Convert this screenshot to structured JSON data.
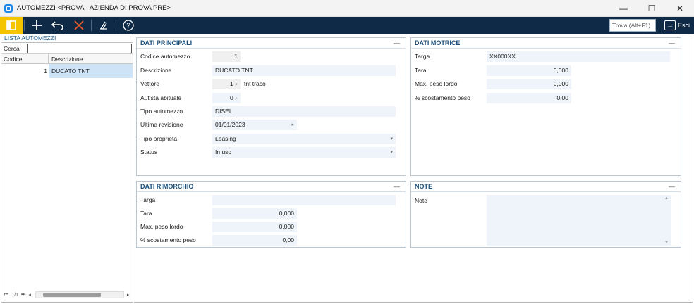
{
  "window": {
    "title": "AUTOMEZZI <PROVA - AZIENDA DI PROVA PRE>",
    "minimize": "—",
    "maximize": "☐",
    "close": "✕"
  },
  "toolbar": {
    "icons": [
      "panel-icon",
      "plus-icon",
      "undo-icon",
      "delete-icon",
      "sign-icon",
      "help-icon"
    ],
    "search_placeholder": "Trova (Alt+F1)",
    "exit_label": "Esci"
  },
  "list": {
    "title": "LISTA AUTOMEZZI",
    "search_label": "Cerca",
    "search_value": "",
    "columns": [
      "Codice",
      "Descrizione"
    ],
    "rows": [
      {
        "code": "1",
        "desc": "DUCATO TNT"
      }
    ],
    "pager": "1/1"
  },
  "dati_principali": {
    "title": "DATI PRINCIPALI",
    "fields": {
      "codice_label": "Codice automezzo",
      "codice_value": "1",
      "descrizione_label": "Descrizione",
      "descrizione_value": "DUCATO TNT",
      "vettore_label": "Vettore",
      "vettore_value": "1",
      "vettore_name": "tnt traco",
      "autista_label": "Autista abituale",
      "autista_value": "0",
      "tipo_label": "Tipo automezzo",
      "tipo_value": "DISEL",
      "revisione_label": "Ultima revisione",
      "revisione_value": "01/01/2023",
      "proprieta_label": "Tipo proprietà",
      "proprieta_value": "Leasing",
      "status_label": "Status",
      "status_value": "In uso"
    }
  },
  "dati_motrice": {
    "title": "DATI MOTRICE",
    "targa_label": "Targa",
    "targa_value": "XX000XX",
    "tara_label": "Tara",
    "tara_value": "0,000",
    "peso_label": "Max. peso lordo",
    "peso_value": "0,000",
    "scost_label": "% scostamento peso",
    "scost_value": "0,00"
  },
  "dati_rimorchio": {
    "title": "DATI RIMORCHIO",
    "targa_label": "Targa",
    "targa_value": "",
    "tara_label": "Tara",
    "tara_value": "0,000",
    "peso_label": "Max. peso lordo",
    "peso_value": "0,000",
    "scost_label": "% scostamento peso",
    "scost_value": "0,00"
  },
  "note": {
    "title": "NOTE",
    "label": "Note",
    "value": ""
  },
  "colors": {
    "toolbar_bg": "#0e2a47",
    "primary_button": "#f5c400",
    "field_bg": "#eef4fa",
    "selected_row": "#cfe3f7"
  }
}
